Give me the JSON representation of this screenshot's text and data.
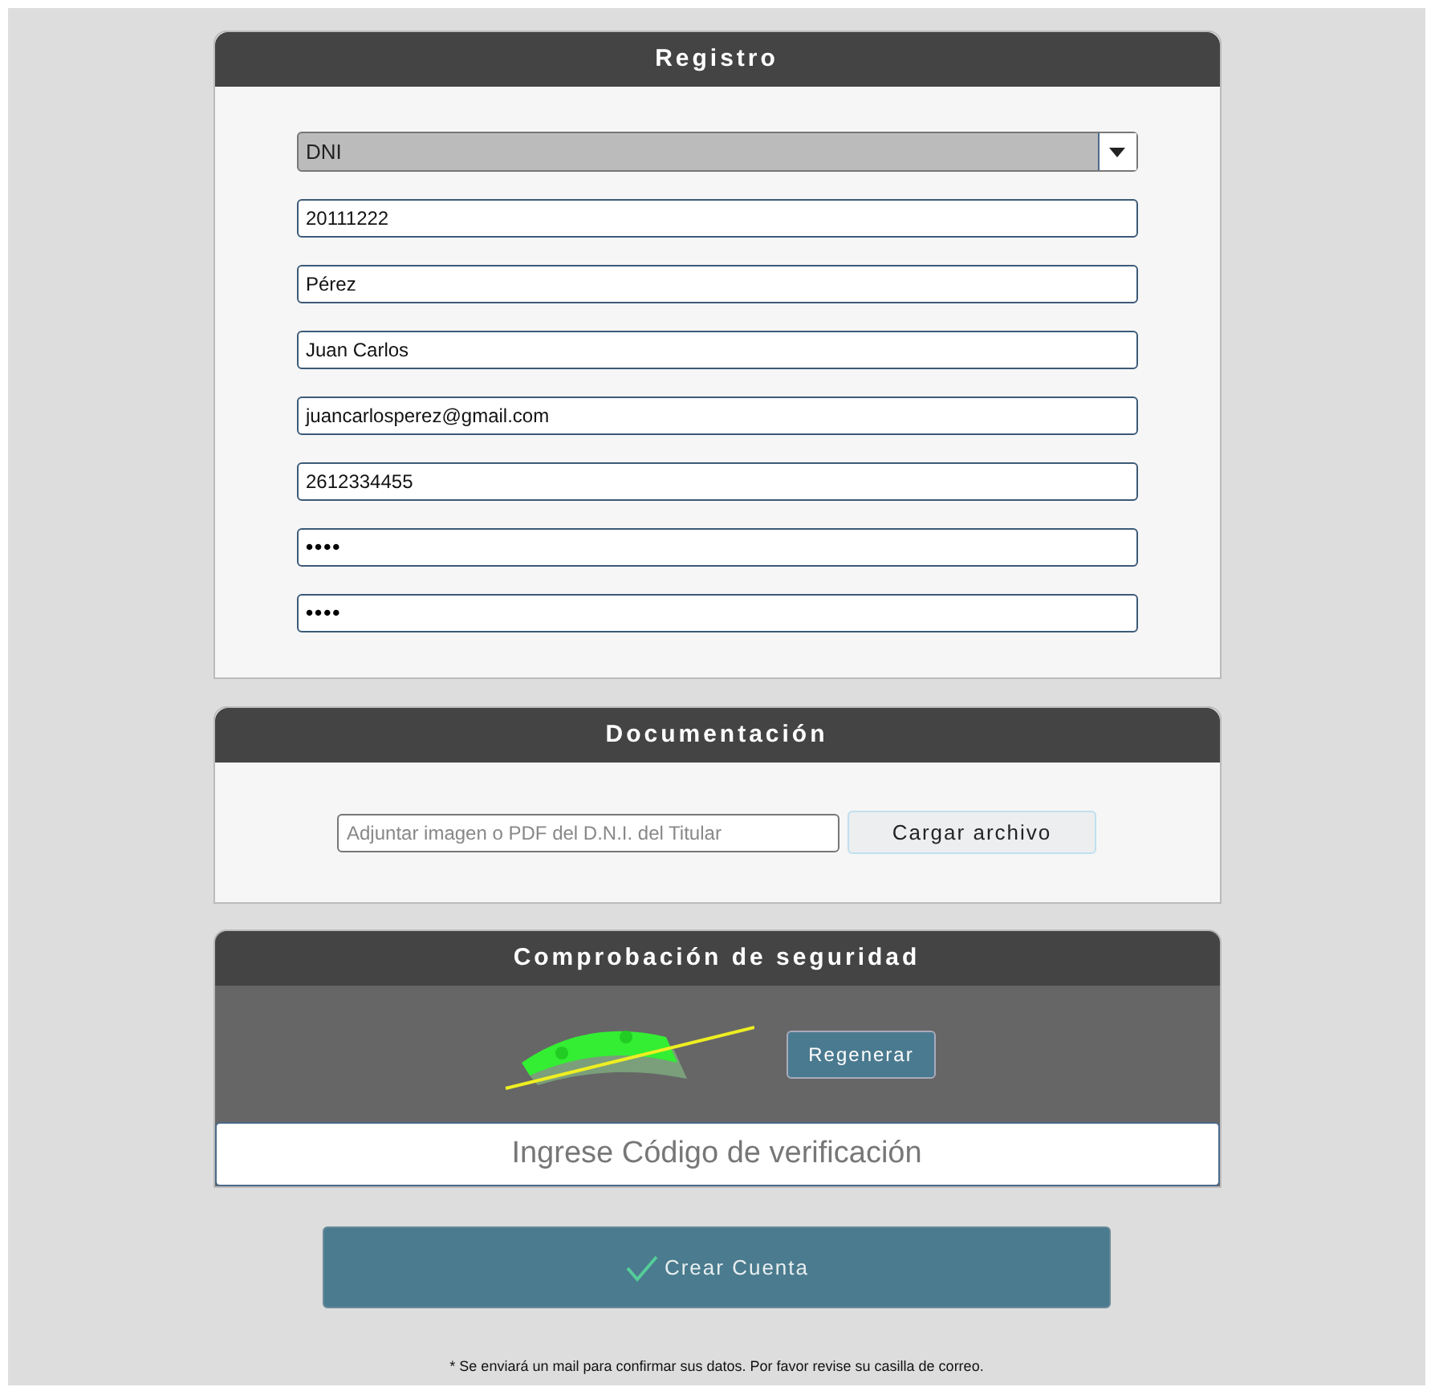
{
  "registro": {
    "title": "Registro",
    "document_type": {
      "value": "DNI"
    },
    "fields": [
      {
        "kind": "text",
        "value": "20111222"
      },
      {
        "kind": "text",
        "value": "Pérez"
      },
      {
        "kind": "text",
        "value": "Juan Carlos"
      },
      {
        "kind": "text",
        "value": "juancarlosperez@gmail.com"
      },
      {
        "kind": "text",
        "value": "2612334455"
      },
      {
        "kind": "password",
        "value": "••••"
      },
      {
        "kind": "password",
        "value": "••••"
      }
    ]
  },
  "documentacion": {
    "title": "Documentación",
    "file_field": {
      "placeholder": "Adjuntar imagen o PDF del D.N.I. del Titular"
    },
    "upload_button": "Cargar archivo"
  },
  "seguridad": {
    "title": "Comprobación de seguridad",
    "regenerate_button": "Regenerar",
    "code_field": {
      "placeholder": "Ingrese Código de verificación"
    }
  },
  "submit_button": "Crear Cuenta",
  "footnote": "* Se enviará un mail para confirmar sus datos. Por favor revise su casilla de correo."
}
